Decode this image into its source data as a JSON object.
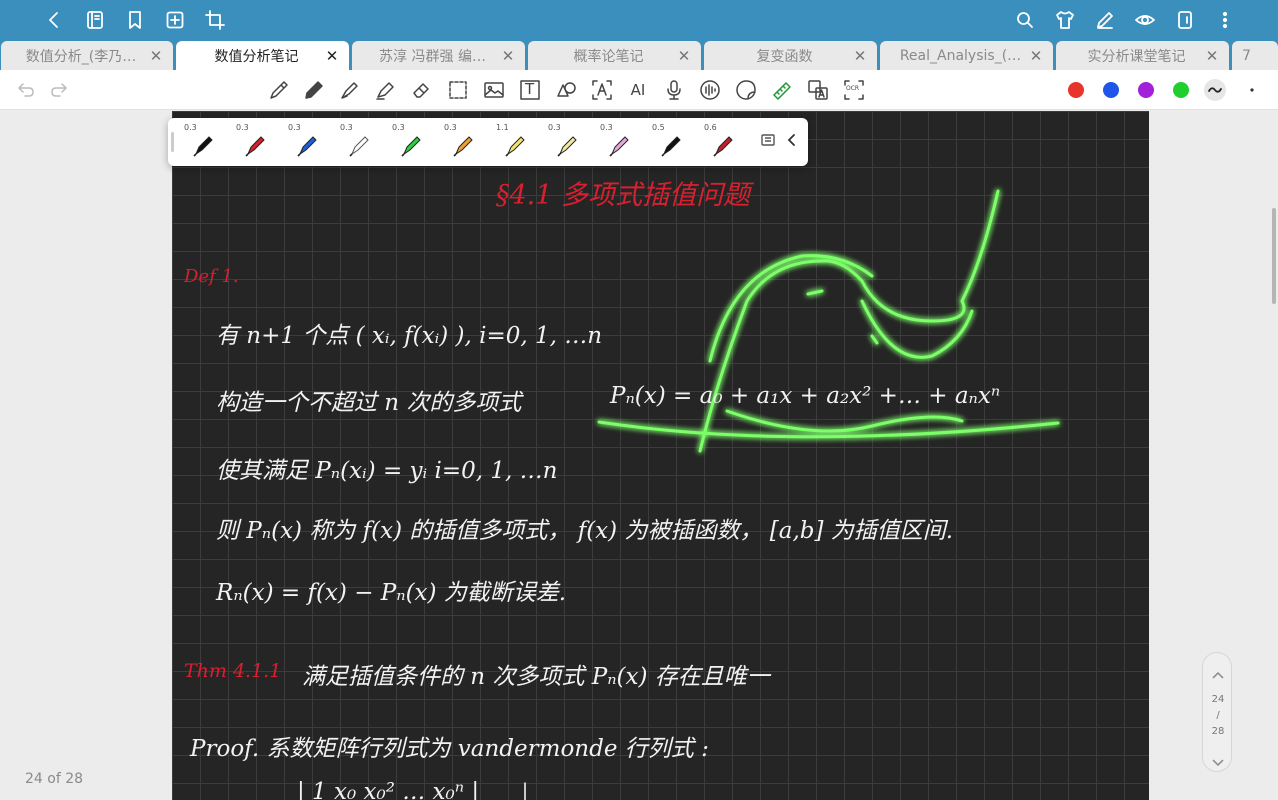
{
  "topbar": {
    "icons_left": [
      "back-icon",
      "notebook-icon",
      "bookmark-icon",
      "add-page-icon",
      "crop-icon"
    ],
    "icons_right": [
      "search-icon",
      "shirt-icon",
      "pen-edit-icon",
      "eye-icon",
      "tablet-icon",
      "more-vertical-icon"
    ]
  },
  "tabs": [
    {
      "label": "数值分析_(李乃…",
      "active": false
    },
    {
      "label": "数值分析笔记",
      "active": true
    },
    {
      "label": "苏淳 冯群强 编…",
      "active": false
    },
    {
      "label": "概率论笔记",
      "active": false
    },
    {
      "label": "复变函数",
      "active": false
    },
    {
      "label": "Real_Analysis_(…",
      "active": false
    },
    {
      "label": "实分析课堂笔记",
      "active": false
    },
    {
      "label": "7",
      "active": false
    }
  ],
  "toolbar": {
    "tools": [
      "pen-icon",
      "pencil-icon",
      "fountain-pen-icon",
      "highlighter-icon",
      "eraser-icon",
      "lasso-select-icon",
      "image-icon",
      "text-box-icon",
      "shape-icon",
      "text-recognize-icon",
      "ai-icon",
      "microphone-icon",
      "audio-icon",
      "sticker-icon",
      "ruler-icon",
      "translate-icon",
      "ocr-icon"
    ],
    "text_tool_label": "T",
    "ai_label": "AI",
    "ocr_label": "OCR",
    "colors": [
      "#e8342b",
      "#1f55e8",
      "#a41fd8",
      "#1fcf2e"
    ]
  },
  "pen_presets": [
    {
      "size": "0.3",
      "color": "#111111"
    },
    {
      "size": "0.3",
      "color": "#d62029"
    },
    {
      "size": "0.3",
      "color": "#1f5fd6"
    },
    {
      "size": "0.3",
      "color": "#ffffff"
    },
    {
      "size": "0.3",
      "color": "#2ecc40"
    },
    {
      "size": "0.3",
      "color": "#f0a030"
    },
    {
      "size": "1.1",
      "color": "#f2e16a"
    },
    {
      "size": "0.3",
      "color": "#f2e8a0"
    },
    {
      "size": "0.3",
      "color": "#e6a8d8"
    },
    {
      "size": "0.5",
      "color": "#111111"
    },
    {
      "size": "0.6",
      "color": "#c0202a"
    }
  ],
  "notes": {
    "section_title": "§4.1   多项式插值问题",
    "def_label": "Def 1.",
    "line1": "有 n+1 个点  ( xᵢ, f(xᵢ) ),     i=0, 1, …n",
    "line2a": "构造一个不超过 n 次的多项式",
    "line2b": "Pₙ(x) =  a₀ + a₁x + a₂x² +… + aₙxⁿ",
    "line3": "使其满足   Pₙ(xᵢ) = yᵢ        i=0, 1, …n",
    "line4": "则 Pₙ(x) 称为 f(x) 的插值多项式，  f(x) 为被插函数，  [a,b] 为插值区间.",
    "line5": "Rₙ(x) =  f(x) − Pₙ(x) 为截断误差.",
    "thm_label": "Thm 4.1.1",
    "thm_text": "满足插值条件的 n 次多项式  Pₙ(x) 存在且唯一",
    "proof_text": "Proof. 系数矩阵行列式为 vandermonde 行列式 :",
    "matrix_row": "| 1   x₀   x₀²   …   x₀ⁿ |"
  },
  "status": {
    "page_counter": "24 of 28",
    "current_page": "24",
    "separator": "/",
    "total_pages": "28"
  }
}
